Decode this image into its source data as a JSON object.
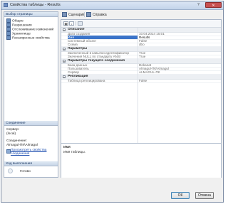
{
  "window": {
    "title": "Свойства таблицы - Results",
    "close_icon": "close-icon",
    "help_icon": "help-icon"
  },
  "sidebar": {
    "header": "Выбор страницы",
    "items": [
      {
        "label": "Общие",
        "icon": "page-icon"
      },
      {
        "label": "Разрешения",
        "icon": "page-icon"
      },
      {
        "label": "Отслеживание изменений",
        "icon": "page-icon"
      },
      {
        "label": "Хранилище",
        "icon": "page-icon"
      },
      {
        "label": "Расширенные свойства",
        "icon": "page-icon"
      }
    ]
  },
  "connection": {
    "header": "Соединение",
    "server_label": "Сервер:",
    "server_value": "(local)",
    "connection_label": "Соединение:",
    "connection_value": "Almagul-ПК\\Almagul",
    "link_line1": "Просмотреть свойства",
    "link_line2": "соединения"
  },
  "progress": {
    "header": "Ход выполнения",
    "status": "Готово"
  },
  "toolbar": {
    "script_label": "Сценарий",
    "help_label": "Справка",
    "dropdown_arrow": "▼"
  },
  "grid_toolbar": {
    "categorized": "▦",
    "alphabetical": "↓"
  },
  "properties": {
    "categories": [
      {
        "label": "Описание",
        "toggle": "−",
        "rows": [
          {
            "name": "Дата создания",
            "value": "10.04.2014 15:01"
          },
          {
            "name": "Имя",
            "value": "Results",
            "selected": true
          },
          {
            "name": "Системный объект",
            "value": "False"
          },
          {
            "name": "Схема",
            "value": "dbo"
          }
        ]
      },
      {
        "label": "Параметры",
        "toggle": "−",
        "rows": [
          {
            "name": "Заключенный в кавычки идентификатор",
            "value": "True"
          },
          {
            "name": "Значения NULL по стандарту ANSI",
            "value": "True"
          }
        ]
      },
      {
        "label": "Параметры текущего соединения",
        "toggle": "−",
        "rows": [
          {
            "name": "База данных",
            "value": "Dekanat"
          },
          {
            "name": "Пользователь",
            "value": "Almagul-ПК\\Almagul"
          },
          {
            "name": "Сервер",
            "value": "ALMAGUL-ПК"
          }
        ]
      },
      {
        "label": "Репликация",
        "toggle": "−",
        "rows": [
          {
            "name": "Таблица реплицирована",
            "value": "False"
          }
        ]
      }
    ]
  },
  "description": {
    "title": "Имя",
    "text": "Имя таблицы."
  },
  "buttons": {
    "ok": "ОК",
    "cancel": "Отмена"
  }
}
